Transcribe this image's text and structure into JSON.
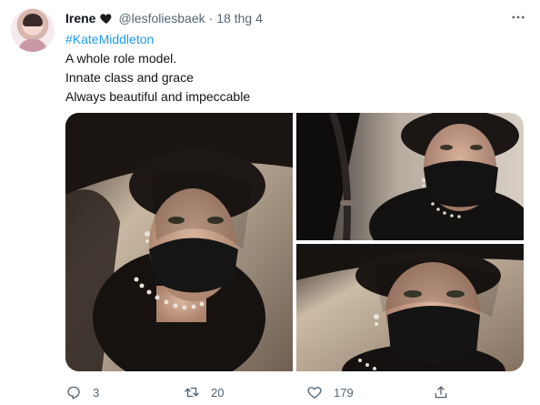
{
  "tweet": {
    "author_name": "Irene",
    "author_emoji_icon": "black-heart-icon",
    "handle": "@lesfoliesbaek",
    "separator": "·",
    "date": "18 thg 4",
    "hashtag": "#KateMiddleton",
    "lines": [
      "A whole role model.",
      "Innate class and grace",
      "Always beautiful and impeccable"
    ],
    "photos": [
      {
        "subject": "woman in black hat with veil and black face mask, pearl necklace"
      },
      {
        "subject": "woman in black mask seated in car"
      },
      {
        "subject": "close-up of woman in veil and black face mask"
      }
    ]
  },
  "actions": {
    "reply_count": "3",
    "retweet_count": "20",
    "like_count": "179"
  },
  "colors": {
    "accent": "#1d9bf0",
    "muted": "#536471",
    "text": "#0f1419"
  }
}
